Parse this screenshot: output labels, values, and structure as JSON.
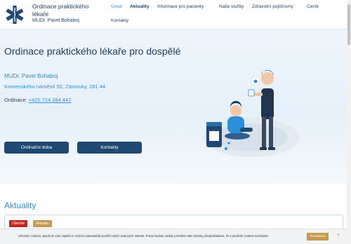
{
  "brand": {
    "title": "Ordinace praktického lékaře",
    "subtitle": "MUDr. Pavel Bohaboj",
    "logo_icon": "star-of-life-icon",
    "logo_color": "#1f4872"
  },
  "nav": {
    "items": [
      {
        "label": "Úvod",
        "state": "active"
      },
      {
        "label": "Aktuality",
        "state": "bold"
      },
      {
        "label": "Informace pro pacienty",
        "state": ""
      },
      {
        "label": "Naše služby",
        "state": ""
      },
      {
        "label": "Zdravotní pojišťovny",
        "state": ""
      },
      {
        "label": "Ceník",
        "state": ""
      },
      {
        "label": "Kontakty",
        "state": ""
      }
    ]
  },
  "hero": {
    "title": "Ordinace praktického lékaře pro dospělé",
    "doctor": "MUDr. Pavel Bohaboj",
    "address": "Komenského náměstí 92, Zásmuky, 281 44",
    "phone_label": "Ordinace:",
    "phone": "+420 724 284 447",
    "buttons": {
      "hours": "Ordinační doba",
      "contacts": "Kontakty"
    },
    "illustration": "doctor-patient-illustration"
  },
  "news": {
    "title": "Aktuality",
    "badges": [
      {
        "label": "Důležité",
        "color": "#c0281f"
      },
      {
        "label": "Aktuality",
        "color": "#c49a4f"
      }
    ]
  },
  "cookie": {
    "text": "Užíváme cookies, abychom vám zajistili co možná nejsnadnější použití našich webových stránek. Pokud budete nadále prohlížet naše stránky předpokládáme, že s použitím cookies souhlasíte.",
    "accept": "Souhlasím",
    "close": "×"
  },
  "colors": {
    "primary": "#1f4872",
    "accent": "#2a8fd6",
    "gold": "#c49a4f",
    "danger": "#c0281f"
  }
}
